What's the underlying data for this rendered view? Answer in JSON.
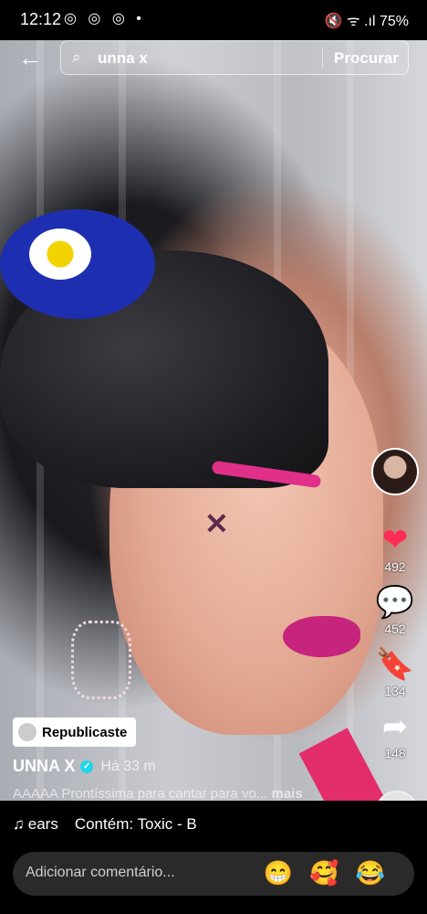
{
  "status": {
    "time": "12:12",
    "battery": "75%",
    "left_icons": "◎ ◎ ◎ •",
    "right_icons": "🔇 ᯤ .ıl"
  },
  "search": {
    "query": "unna x",
    "button_label": "Procurar"
  },
  "rail": {
    "likes": "492",
    "comments": "452",
    "saves": "134",
    "shares": "148"
  },
  "post": {
    "repost_label": "Republicaste",
    "author": "UNNA X",
    "time_ago": "Há 33 m",
    "caption": "AAAAA Prontíssima para cantar para vo...",
    "more_label": "mais"
  },
  "music": {
    "track": "ears",
    "content": "Contém: Toxic - B"
  },
  "comment": {
    "placeholder": "Adicionar comentário...",
    "emojis": [
      "😁",
      "🥰",
      "😂"
    ]
  },
  "colors": {
    "like": "#fe2c55",
    "save": "#ffc300",
    "verified": "#20d5ec"
  }
}
